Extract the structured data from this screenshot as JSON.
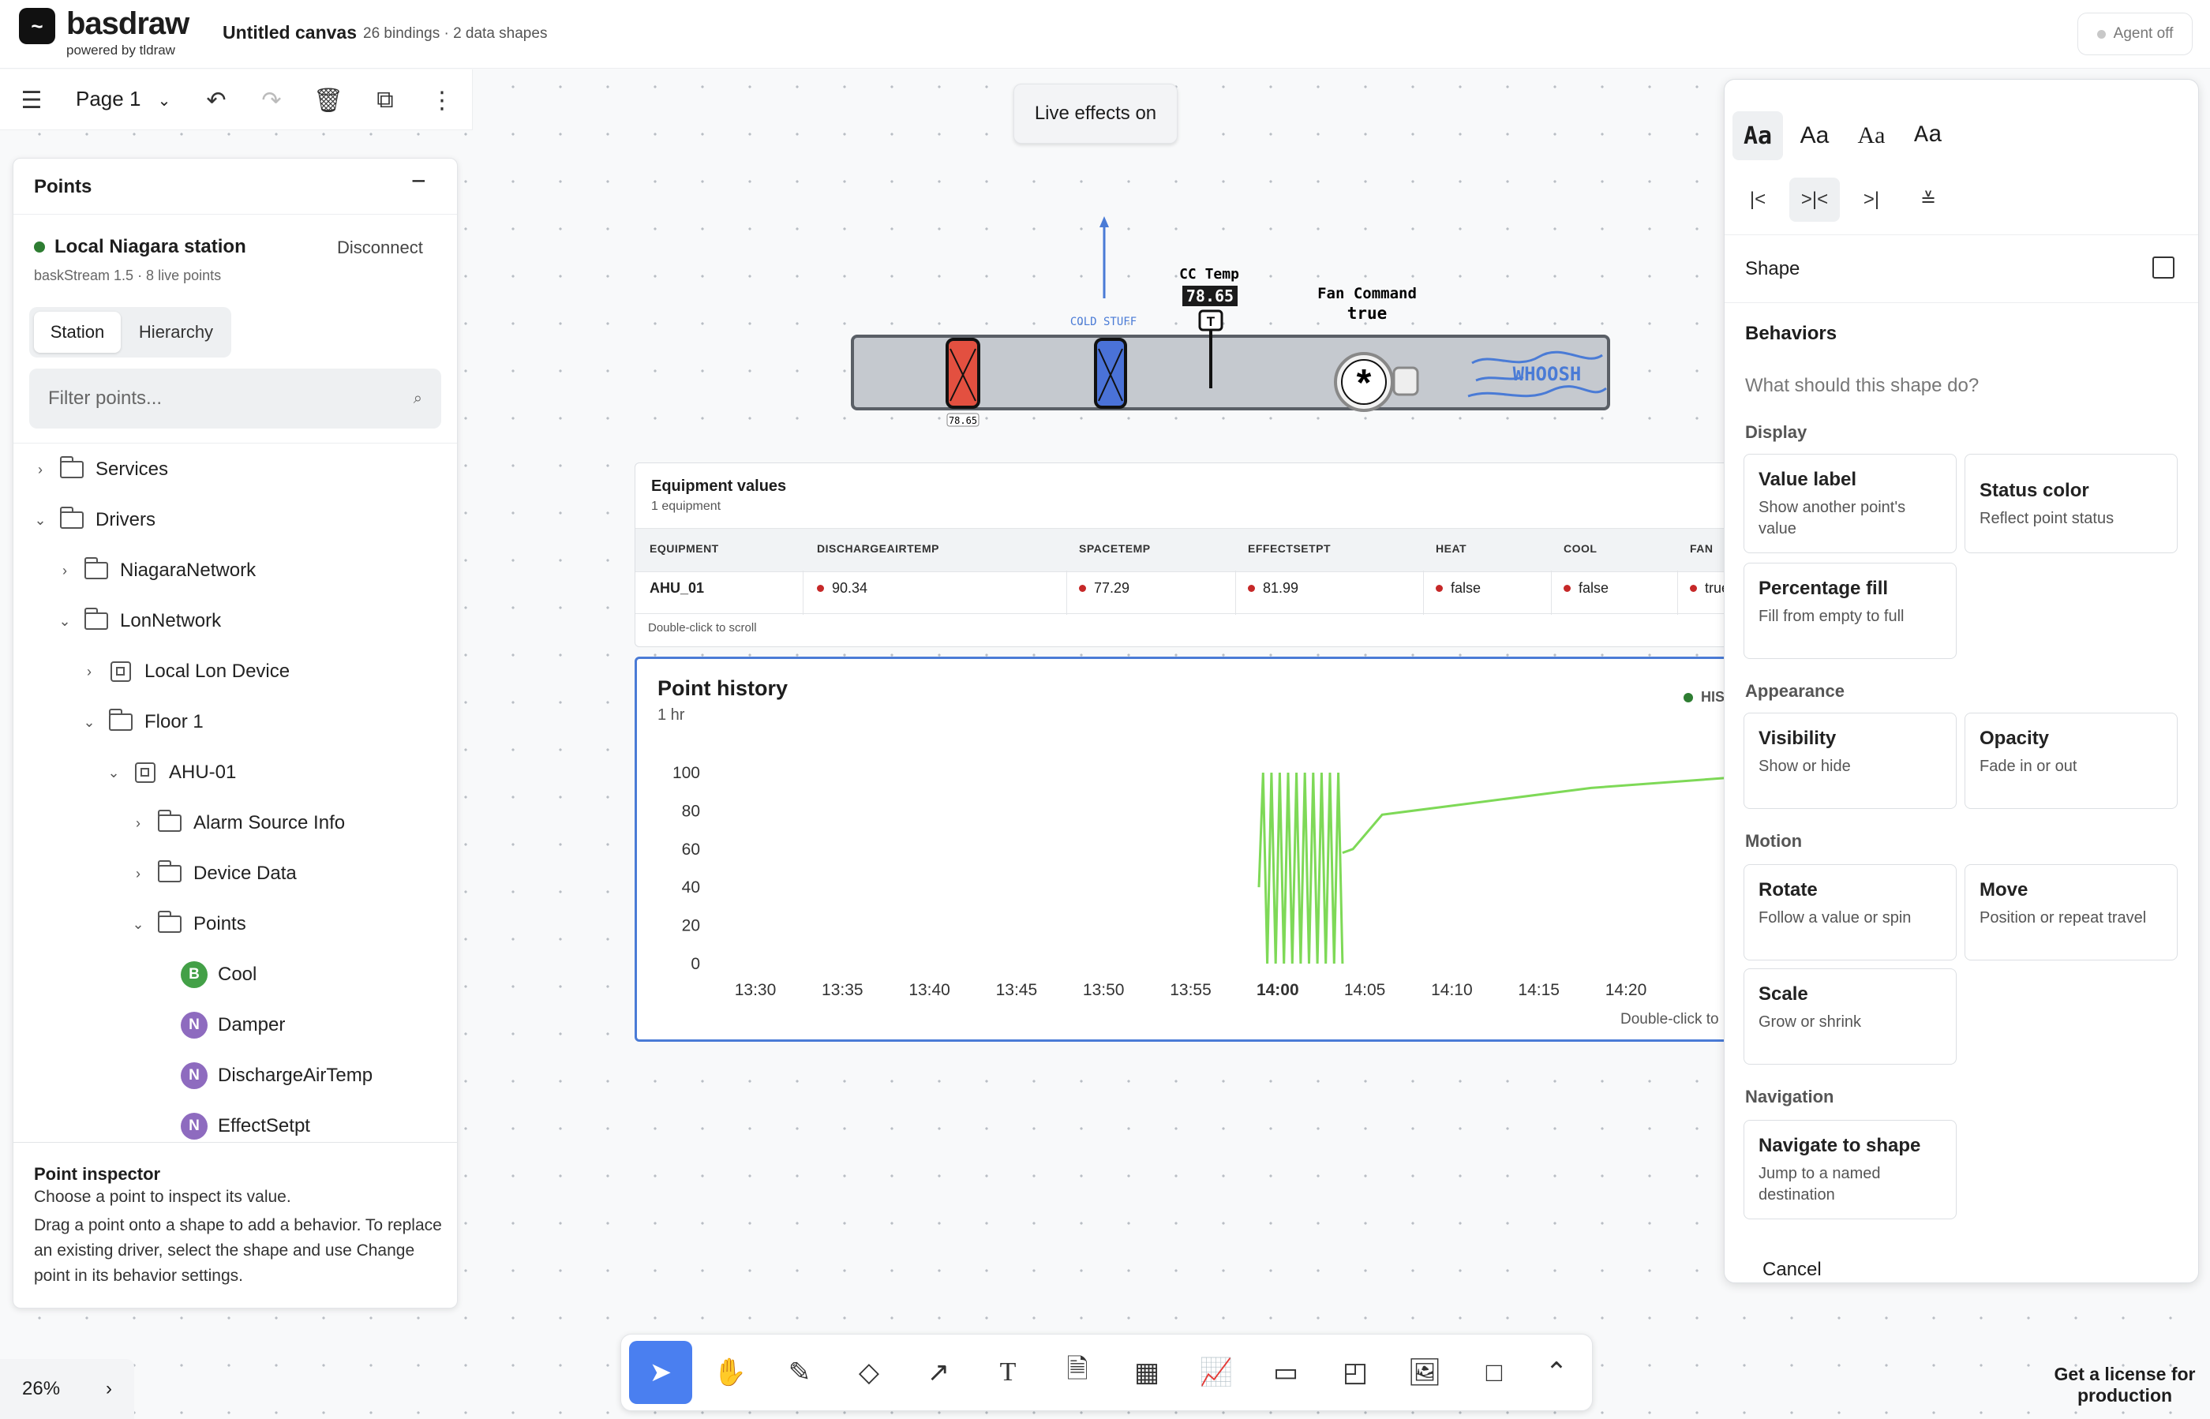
{
  "app": {
    "brand": "basdraw",
    "brand_sub": "powered by tldraw",
    "canvas_title": "Untitled canvas",
    "canvas_meta": "26 bindings · 2 data shapes",
    "agent_label": "Agent off"
  },
  "pagebar": {
    "page_name": "Page 1"
  },
  "points_panel": {
    "title": "Points",
    "station_name": "Local Niagara station",
    "disconnect_label": "Disconnect",
    "version": "baskStream 1.5  ·  8 live points",
    "tabs": [
      "Station",
      "Hierarchy"
    ],
    "filter_placeholder": "Filter points...",
    "tree": [
      {
        "label": "Services",
        "type": "folder",
        "level": 0,
        "state": "collapsed",
        "alert": false
      },
      {
        "label": "Drivers",
        "type": "folder",
        "level": 0,
        "state": "expanded",
        "alert": false
      },
      {
        "label": "NiagaraNetwork",
        "type": "folder",
        "level": 1,
        "state": "collapsed",
        "alert": false
      },
      {
        "label": "LonNetwork",
        "type": "folder",
        "level": 1,
        "state": "expanded",
        "alert": true
      },
      {
        "label": "Local Lon Device",
        "type": "device",
        "level": 2,
        "state": "collapsed",
        "alert": true
      },
      {
        "label": "Floor 1",
        "type": "folder",
        "level": 2,
        "state": "expanded",
        "alert": false
      },
      {
        "label": "AHU-01",
        "type": "device",
        "level": 3,
        "state": "expanded",
        "alert": true
      },
      {
        "label": "Alarm Source Info",
        "type": "folder",
        "level": 4,
        "state": "collapsed",
        "alert": false
      },
      {
        "label": "Device Data",
        "type": "folder",
        "level": 4,
        "state": "collapsed",
        "alert": false
      },
      {
        "label": "Points",
        "type": "folder",
        "level": 4,
        "state": "expanded",
        "alert": false
      },
      {
        "label": "Cool",
        "type": "point",
        "badge": "B",
        "level": 5,
        "alert": true
      },
      {
        "label": "Damper",
        "type": "point",
        "badge": "N",
        "level": 5,
        "alert": true
      },
      {
        "label": "DischargeAirTemp",
        "type": "point",
        "badge": "N",
        "level": 5,
        "alert": true
      },
      {
        "label": "EffectSetpt",
        "type": "point",
        "badge": "N",
        "level": 5,
        "alert": true
      }
    ],
    "alert_mark": "!",
    "inspector": {
      "title": "Point inspector",
      "line1": "Choose a point to inspect its value.",
      "line2": "Drag a point onto a shape to add a behavior. To replace an existing driver, select the shape and use Change point in its behavior settings."
    }
  },
  "zoom": {
    "level": "26%"
  },
  "live_effects_label": "Live effects on",
  "duct": {
    "cold_label": "COLD STUFF",
    "temp_title": "CC Temp",
    "temp_value": "78.65",
    "sensor_mark": "T",
    "damper_value": "78.65",
    "fan_title": "Fan Command",
    "fan_value": "true",
    "whoosh": "WHOOSH"
  },
  "equipment": {
    "title": "Equipment values",
    "subtitle": "1 equipment",
    "columns": [
      "EQUIPMENT",
      "DISCHARGEAIRTEMP",
      "SPACETEMP",
      "EFFECTSETPT",
      "HEAT",
      "COOL",
      "FAN"
    ],
    "row": [
      "AHU_01",
      "90.34",
      "77.29",
      "81.99",
      "false",
      "false",
      "true"
    ],
    "hint": "Double-click to scroll"
  },
  "point_history": {
    "title": "Point history",
    "range": "1 hr",
    "legend": "HIS",
    "hint": "Double-click to",
    "colors": {
      "series": "#7ed957",
      "frame": "#4a7bd6"
    },
    "chart_data": {
      "type": "line",
      "ylim": [
        0,
        100
      ],
      "yticks": [
        0,
        20,
        40,
        60,
        80,
        100
      ],
      "xticks": [
        "13:30",
        "13:35",
        "13:40",
        "13:45",
        "13:50",
        "13:55",
        "14:00",
        "14:05",
        "14:10",
        "14:15",
        "14:20"
      ],
      "bold_tick": "14:00",
      "series": [
        {
          "x": [
            13.982,
            13.986,
            13.99,
            13.994,
            13.998,
            14.002,
            14.006,
            14.01,
            14.014,
            14.018,
            14.022,
            14.026,
            14.03,
            14.034,
            14.038,
            14.042,
            14.046,
            14.05,
            14.054,
            14.058,
            14.062,
            14.5,
            14.502,
            14.506,
            14.51,
            14.514,
            14.518,
            14.522
          ],
          "y": [
            40,
            100,
            0,
            100,
            0,
            100,
            0,
            100,
            0,
            100,
            0,
            100,
            0,
            100,
            0,
            100,
            0,
            100,
            0,
            100,
            0,
            58,
            60,
            100,
            100,
            0,
            100,
            0
          ],
          "note": "x in hours of day"
        }
      ]
    }
  },
  "right_panel": {
    "font_options": [
      "Aa",
      "Aa",
      "Aa",
      "Aa"
    ],
    "align_options": [
      "|<",
      ">|<",
      ">|",
      "≚"
    ],
    "shape_label": "Shape",
    "behaviors_title": "Behaviors",
    "question": "What should this shape do?",
    "sections": [
      {
        "label": "Display",
        "cards": [
          {
            "title": "Value label",
            "desc": "Show another point's value"
          },
          {
            "title": "Status color",
            "desc": "Reflect point status"
          },
          {
            "title": "Percentage fill",
            "desc": "Fill from empty to full"
          }
        ]
      },
      {
        "label": "Appearance",
        "cards": [
          {
            "title": "Visibility",
            "desc": "Show or hide"
          },
          {
            "title": "Opacity",
            "desc": "Fade in or out"
          }
        ]
      },
      {
        "label": "Motion",
        "cards": [
          {
            "title": "Rotate",
            "desc": "Follow a value or spin"
          },
          {
            "title": "Move",
            "desc": "Position or repeat travel"
          },
          {
            "title": "Scale",
            "desc": "Grow or shrink"
          }
        ]
      },
      {
        "label": "Navigation",
        "cards": [
          {
            "title": "Navigate to shape",
            "desc": "Jump to a named destination"
          }
        ]
      }
    ],
    "cancel_label": "Cancel"
  },
  "toolbar": {
    "tools": [
      "select-icon",
      "hand-icon",
      "pencil-icon",
      "eraser-icon",
      "arrow-icon",
      "text-icon",
      "document-icon",
      "table-icon",
      "chart-icon",
      "browser-icon",
      "sticky-note-icon",
      "image-icon",
      "rectangle-icon",
      "chevron-up-icon"
    ],
    "selected": "select-icon"
  },
  "license": "Get a license for production"
}
